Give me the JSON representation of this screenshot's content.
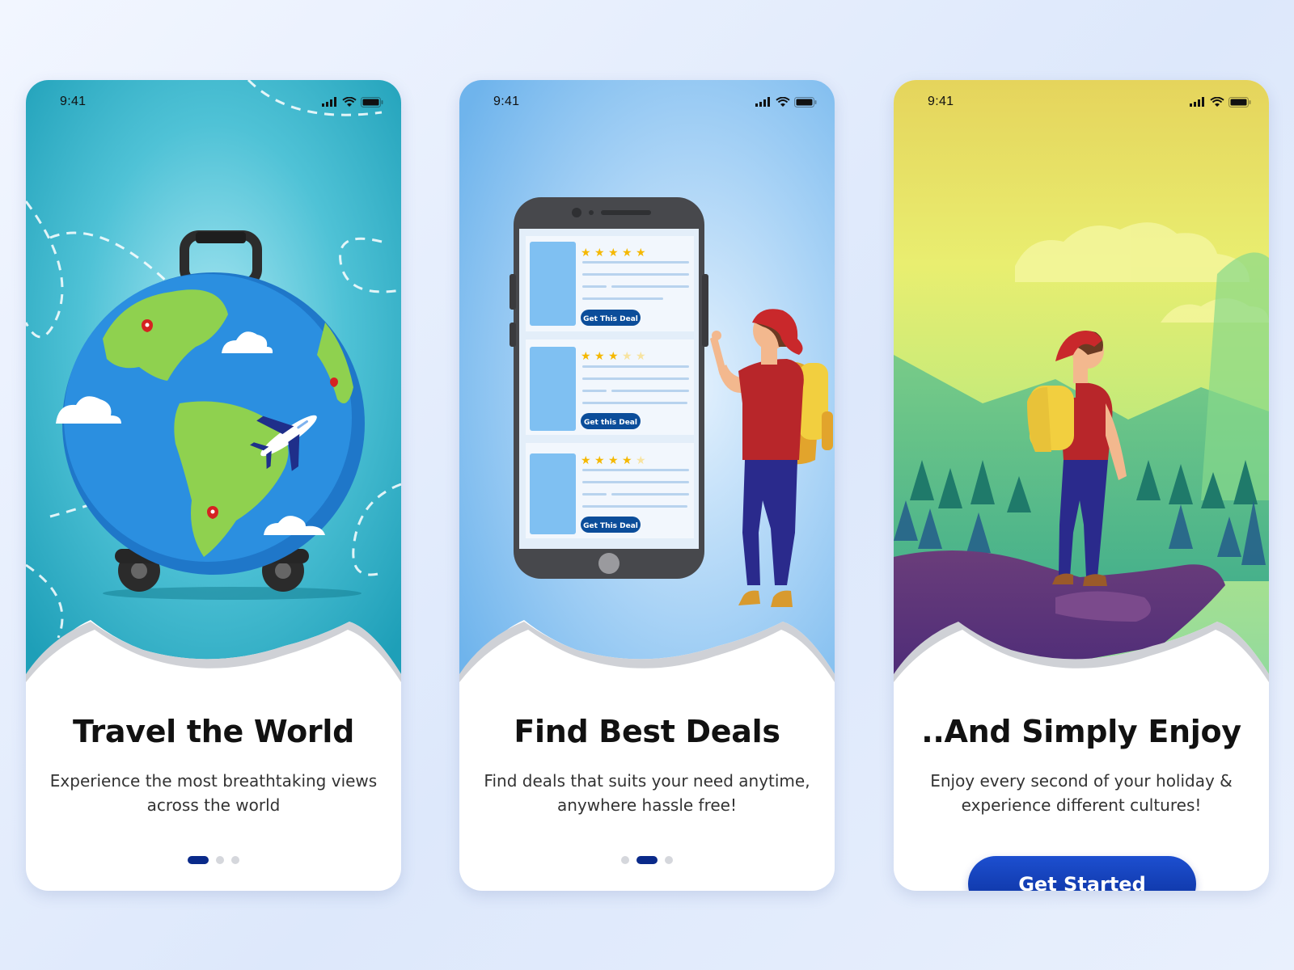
{
  "status_bar": {
    "time": "9:41"
  },
  "screens": [
    {
      "title": "Travel the World",
      "subtitle": "Experience the most breathtaking views across the world",
      "active_page": 1,
      "page_count": 3
    },
    {
      "title": "Find Best Deals",
      "subtitle": "Find deals that suits your need anytime, anywhere hassle free!",
      "active_page": 2,
      "page_count": 3,
      "deals": [
        {
          "button_label": "Get This Deal",
          "rating": 5
        },
        {
          "button_label": "Get this Deal",
          "rating": 3
        },
        {
          "button_label": "Get This Deal",
          "rating": 4
        }
      ]
    },
    {
      "title": "..And Simply Enjoy",
      "subtitle": "Enjoy every second of your holiday & experience different cultures!",
      "cta_label": "Get Started"
    }
  ],
  "colors": {
    "accent": "#0a2a8a",
    "button": "#1d4fd0",
    "star": "#f5b800",
    "globe_ocean": "#2b8fe0",
    "land": "#8fd14f"
  },
  "icons": [
    "signal-icon",
    "wifi-icon",
    "battery-icon",
    "map-pin-icon",
    "airplane-icon",
    "star-icon"
  ]
}
